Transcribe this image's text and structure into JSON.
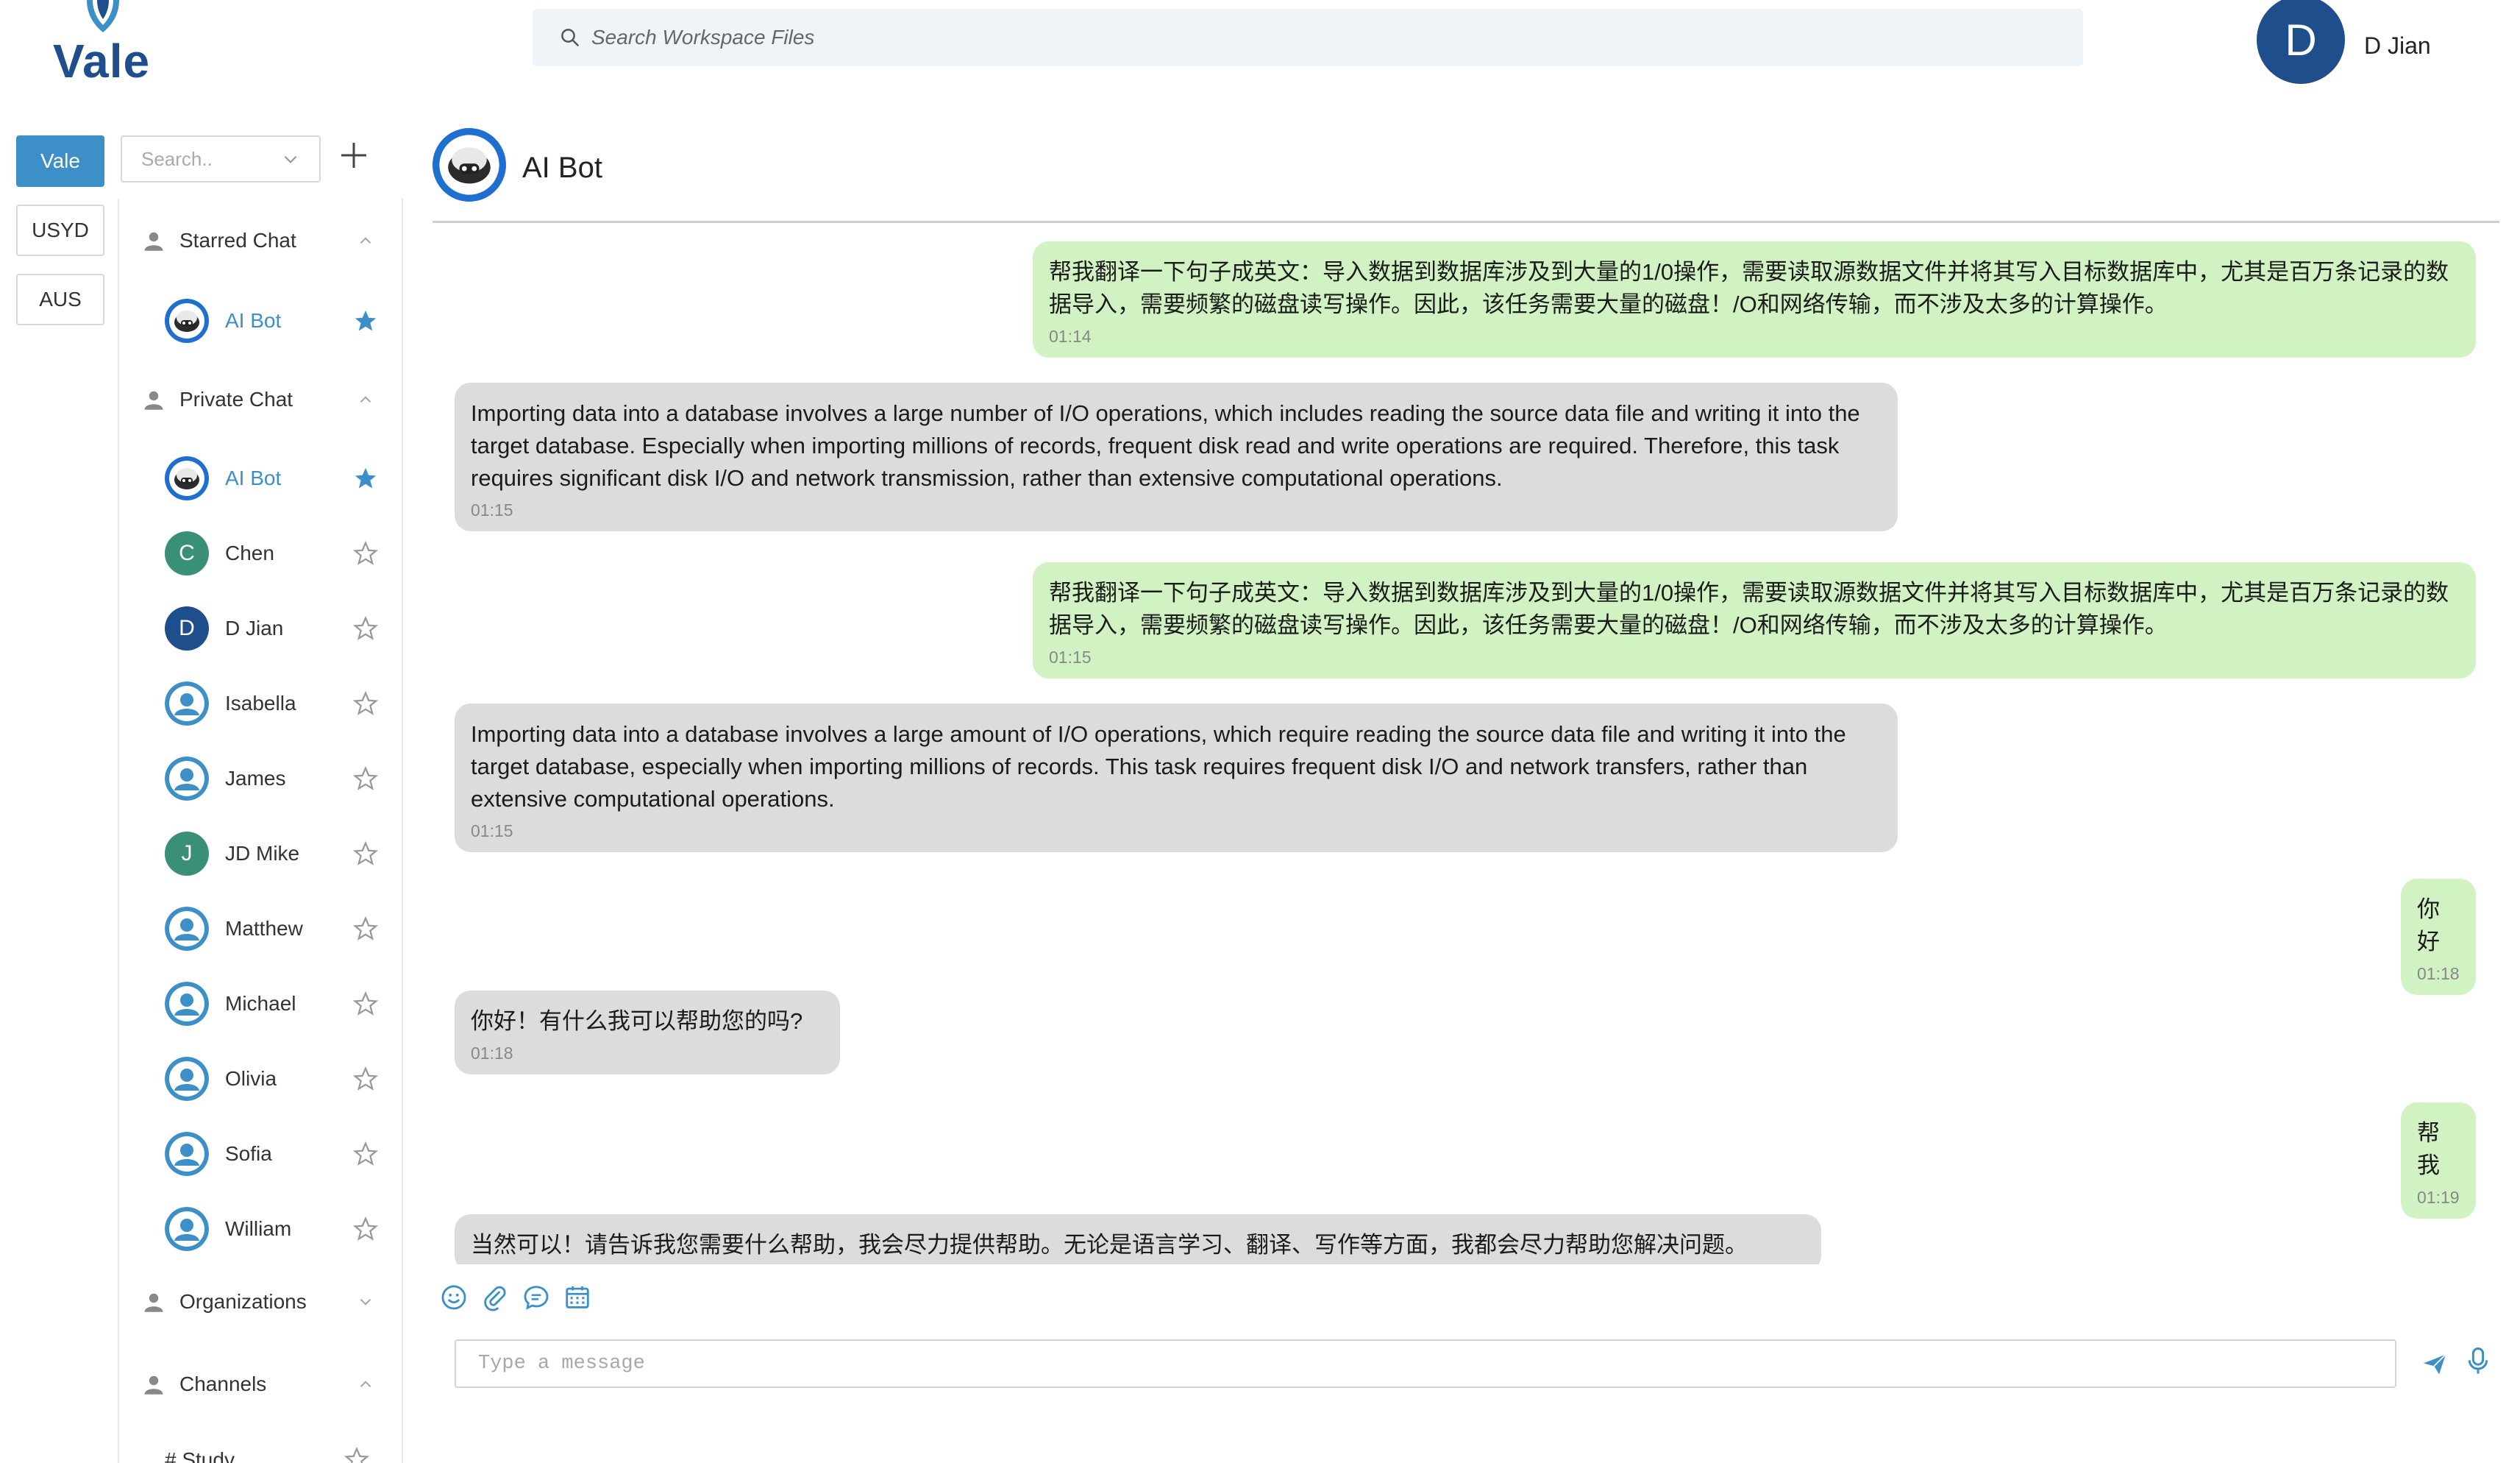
{
  "app": {
    "logo_text": "Vale"
  },
  "header": {
    "search_placeholder": "Search Workspace Files",
    "user_initial": "D",
    "user_name": "D Jian"
  },
  "orgs": [
    {
      "label": "Vale",
      "active": true
    },
    {
      "label": "USYD",
      "active": false
    },
    {
      "label": "AUS",
      "active": false
    }
  ],
  "sidebar": {
    "search_placeholder": "Search..",
    "sections": {
      "starred": "Starred Chat",
      "private": "Private Chat",
      "organizations": "Organizations",
      "channels": "Channels"
    },
    "starred": [
      {
        "name": "AI Bot",
        "starred": true
      }
    ],
    "private": [
      {
        "name": "AI Bot",
        "starred": true,
        "avatar": "bot"
      },
      {
        "name": "Chen",
        "starred": false,
        "avatar": "letter",
        "initial": "C",
        "color": "#3a8f78"
      },
      {
        "name": "D Jian",
        "starred": false,
        "avatar": "letter",
        "initial": "D",
        "color": "#1f4e8c"
      },
      {
        "name": "Isabella",
        "starred": false,
        "avatar": "user"
      },
      {
        "name": "James",
        "starred": false,
        "avatar": "user"
      },
      {
        "name": "JD Mike",
        "starred": false,
        "avatar": "letter",
        "initial": "J",
        "color": "#3a8f78"
      },
      {
        "name": "Matthew",
        "starred": false,
        "avatar": "user"
      },
      {
        "name": "Michael",
        "starred": false,
        "avatar": "user"
      },
      {
        "name": "Olivia",
        "starred": false,
        "avatar": "user"
      },
      {
        "name": "Sofia",
        "starred": false,
        "avatar": "user"
      },
      {
        "name": "William",
        "starred": false,
        "avatar": "user"
      }
    ],
    "channels": [
      {
        "name": "# Study"
      }
    ]
  },
  "chat": {
    "title": "AI Bot",
    "messages": [
      {
        "from": "me",
        "text": "帮我翻译一下句子成英文：导入数据到数据库涉及到大量的1/0操作，需要读取源数据文件并将其写入目标数据库中，尤其是百万条记录的数据导入，需要频繁的磁盘读写操作。因此，该任务需要大量的磁盘！/O和网络传输，而不涉及太多的计算操作。",
        "time": "01:14"
      },
      {
        "from": "bot",
        "text": "Importing data into a database involves a large number of I/O operations, which includes reading the source data file and writing it into the target database. Especially when importing millions of records, frequent disk read and write operations are required. Therefore, this task requires significant disk I/O and network transmission, rather than extensive computational operations.",
        "time": "01:15"
      },
      {
        "from": "me",
        "text": "帮我翻译一下句子成英文：导入数据到数据库涉及到大量的1/0操作，需要读取源数据文件并将其写入目标数据库中，尤其是百万条记录的数据导入，需要频繁的磁盘读写操作。因此，该任务需要大量的磁盘！/O和网络传输，而不涉及太多的计算操作。",
        "time": "01:15"
      },
      {
        "from": "bot",
        "text": "Importing data into a database involves a large amount of I/O operations, which require reading the source data file and writing it into the target database, especially when importing millions of records. This task requires frequent disk I/O and network transfers, rather than extensive computational operations.",
        "time": "01:15"
      },
      {
        "from": "me",
        "text": "你好",
        "time": "01:18"
      },
      {
        "from": "bot",
        "text": "你好！有什么我可以帮助您的吗?",
        "time": "01:18"
      },
      {
        "from": "me",
        "text": "帮我",
        "time": "01:19"
      },
      {
        "from": "bot",
        "text": "当然可以！请告诉我您需要什么帮助，我会尽力提供帮助。无论是语言学习、翻译、写作等方面，我都会尽力帮助您解决问题。",
        "time": ""
      }
    ],
    "composer_placeholder": "Type a message",
    "tool_icons": [
      "emoji-icon",
      "attachment-icon",
      "chat-bubble-icon",
      "calendar-icon"
    ]
  },
  "colors": {
    "accent": "#3d8fc8",
    "brand": "#1f4e8c",
    "me_bubble": "#d1f2c2",
    "bot_bubble": "#dcdcdc"
  }
}
